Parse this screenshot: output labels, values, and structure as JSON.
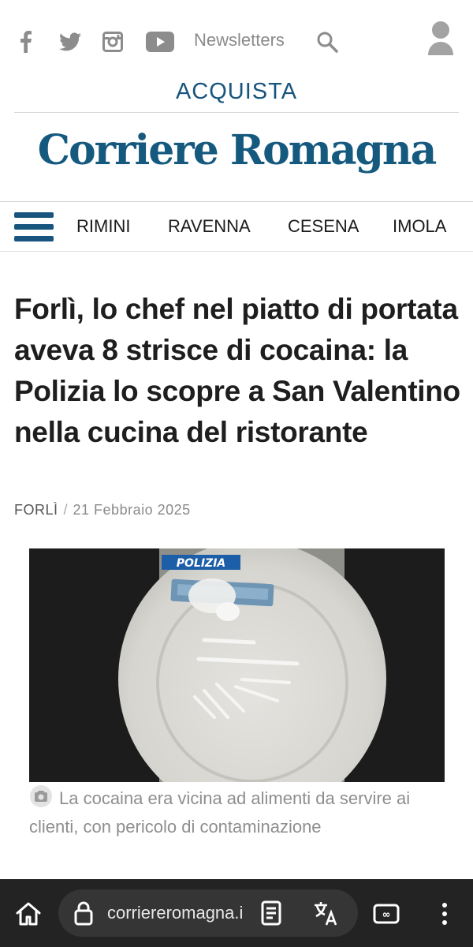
{
  "header": {
    "newsletters_label": "Newsletters",
    "acquista_label": "ACQUISTA",
    "logo_text": "Corriere Romagna",
    "brand_color": "#17557f",
    "social_icons": [
      "facebook-icon",
      "twitter-icon",
      "instagram-icon",
      "youtube-icon"
    ]
  },
  "nav": {
    "items": [
      {
        "label": "RIMINI"
      },
      {
        "label": "RAVENNA"
      },
      {
        "label": "CESENA"
      },
      {
        "label": "IMOLA"
      }
    ]
  },
  "article": {
    "headline": "Forlì, lo chef nel piatto di portata aveva 8 strisce di cocaina: la Polizia lo scopre a San Valentino nella cucina del ristorante",
    "category": "FORLÌ",
    "separator": "/",
    "date": "21 Febbraio 2025",
    "image_badge": "POLIZIA",
    "caption": "La cocaina era vicina ad alimenti da servire ai clienti, con pericolo di contaminazione"
  },
  "browser": {
    "url": "corriereromagna.it",
    "icons": [
      "home-icon",
      "lock-icon",
      "reader-mode-icon",
      "translate-icon",
      "tabs-icon",
      "more-icon"
    ]
  }
}
